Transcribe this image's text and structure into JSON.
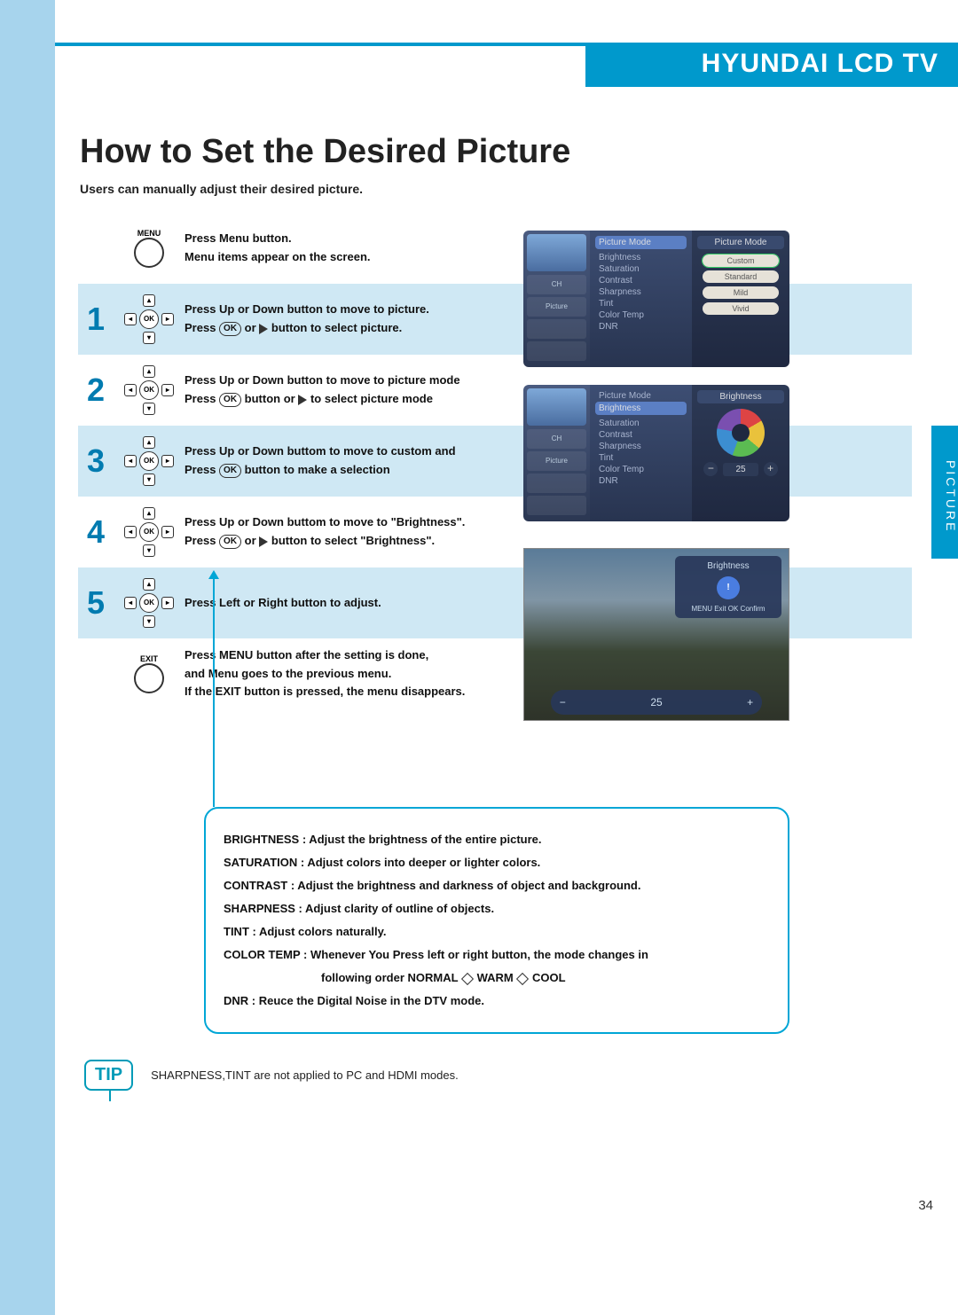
{
  "brand": "HYUNDAI LCD TV",
  "title": "How to Set the Desired Picture",
  "subtitle": "Users can manually adjust their desired picture.",
  "side_tab": "PICTURE",
  "page_number": "34",
  "labels": {
    "menu": "MENU",
    "exit": "EXIT",
    "ok": "OK",
    "or": "or",
    "button_or": "button or",
    "sel_picture": "button to select picture.",
    "sel_picture_mode": "to select picture mode",
    "or_play_brightness": "button to select \"Brightness\"."
  },
  "steps": {
    "menu": {
      "lines": [
        "Press Menu button.",
        "Menu items appear on the screen."
      ]
    },
    "s1": {
      "num": "1",
      "line1": "Press Up or Down button to move to picture.",
      "line2a": "Press"
    },
    "s2": {
      "num": "2",
      "line1": "Press Up or Down button to move to picture mode",
      "line2a": "Press"
    },
    "s3": {
      "num": "3",
      "line1": "Press Up or Down buttom to move to custom and",
      "line2a": "Press",
      "line2b": "button to make a selection"
    },
    "s4": {
      "num": "4",
      "line1": "Press Up or Down buttom to move to \"Brightness\".",
      "line2a": "Press"
    },
    "s5": {
      "num": "5",
      "line1": "Press Left or Right button to adjust."
    },
    "exit": {
      "lines": [
        "Press MENU button after the setting is done,",
        "and Menu goes to the previous menu.",
        "If the EXIT button is pressed, the menu disappears."
      ]
    }
  },
  "osd1": {
    "left_icons": [
      "CH",
      "Picture",
      "",
      ""
    ],
    "mid_hl": "Picture Mode",
    "mid_items": [
      "Brightness",
      "Saturation",
      "Contrast",
      "Sharpness",
      "Tint",
      "Color Temp",
      "DNR"
    ],
    "right_hdr": "Picture Mode",
    "right_opts": [
      "Custom",
      "Standard",
      "Mild",
      "Vivid"
    ]
  },
  "osd2": {
    "left_icons": [
      "CH",
      "Picture",
      "",
      ""
    ],
    "mid_top": "Picture Mode",
    "mid_hl": "Brightness",
    "mid_items": [
      "Saturation",
      "Contrast",
      "Sharpness",
      "Tint",
      "Color Temp",
      "DNR"
    ],
    "right_hdr": "Brightness",
    "slider_val": "25"
  },
  "photo": {
    "ovl_title": "Brightness",
    "ovl_foot": "MENU Exit  OK Confirm",
    "bar_minus": "−",
    "bar_val": "25",
    "bar_plus": "+"
  },
  "callout": {
    "l1": "BRIGHTNESS : Adjust the brightness of the entire picture.",
    "l2": "SATURATION : Adjust colors into deeper or lighter colors.",
    "l3": "CONTRAST : Adjust the brightness and darkness of object and background.",
    "l4": "SHARPNESS : Adjust clarity of outline of objects.",
    "l5": "TINT : Adjust colors naturally.",
    "l6a": "COLOR TEMP : Whenever You Press left or right button, the mode changes in",
    "l6b": "following order NORMAL",
    "l6c": "WARM",
    "l6d": "COOL",
    "l7": "DNR : Reuce the Digital Noise in the DTV mode."
  },
  "tip": {
    "badge": "TIP",
    "text": "SHARPNESS,TINT are not applied to PC and HDMI modes."
  }
}
